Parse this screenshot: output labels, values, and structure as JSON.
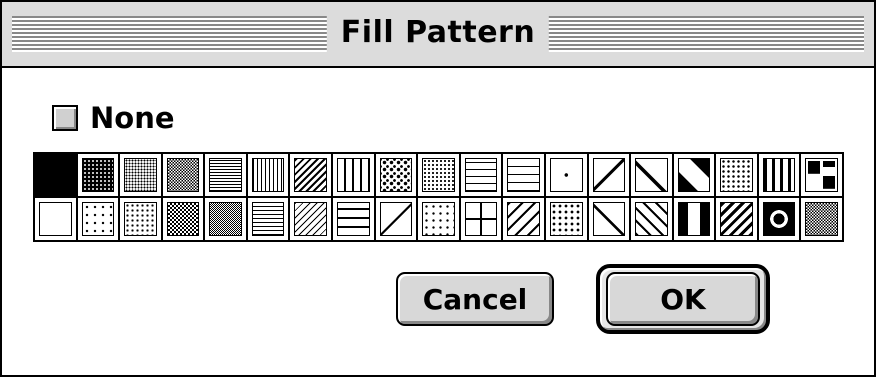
{
  "window": {
    "title": "Fill Pattern"
  },
  "none_option": {
    "label": "None",
    "checked": false
  },
  "palette": {
    "rows": [
      [
        "solid-black",
        "dense-dots",
        "dense-dots-2",
        "fine-gray",
        "fine-grid",
        "vertical-lines",
        "diagonal-lines",
        "vertical-bars",
        "speckle",
        "light-dots",
        "grid",
        "brick",
        "center-dot",
        "arrow",
        "diamond-weave",
        "x-weave",
        "scales",
        "arch-weave",
        "square-blocks"
      ],
      [
        "white",
        "sparse-dots",
        "dots",
        "light-gray",
        "fine-check",
        "horizontal-lines",
        "diagonal-light",
        "horizontal-bars",
        "diagonal-single",
        "corner-dots",
        "cross-grid",
        "diagonal-brick",
        "heart",
        "diamond-dot",
        "wave",
        "bowtie",
        "zigzag",
        "circles",
        "diamond-fill"
      ]
    ]
  },
  "buttons": {
    "cancel_label": "Cancel",
    "ok_label": "OK"
  }
}
